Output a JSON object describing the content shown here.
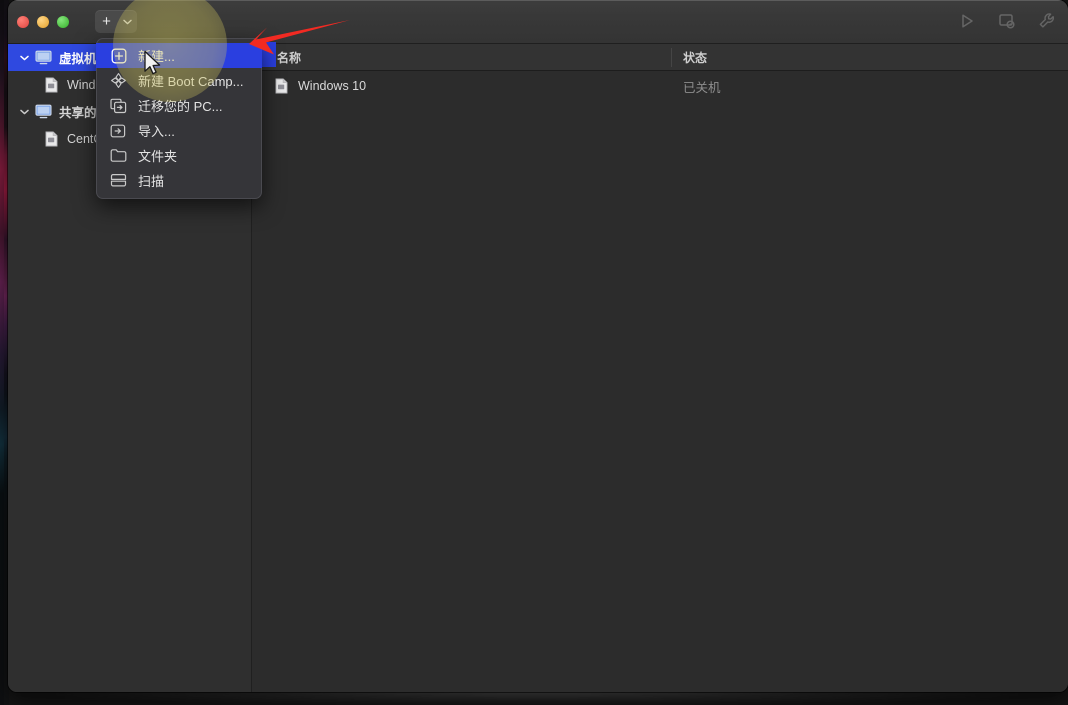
{
  "window": {
    "traffic_lights": [
      "close",
      "minimize",
      "maximize"
    ],
    "toolbar": {
      "add_button_label": "+",
      "add_chevron_icon": "chevron-down-icon",
      "right_icons": [
        "power-start-icon",
        "screenshot-icon",
        "wrench-icon"
      ]
    }
  },
  "sidebar": {
    "groups": [
      {
        "label": "虚拟机",
        "icon": "monitor-icon",
        "chevron": "chevron-down-icon",
        "selected": true,
        "children": [
          {
            "label": "Windows 10",
            "icon": "vm-doc-icon"
          }
        ]
      },
      {
        "label": "共享的",
        "icon": "monitor-icon",
        "chevron": "chevron-down-icon",
        "selected": false,
        "children": [
          {
            "label": "CentOS 7",
            "icon": "vm-doc-icon"
          }
        ]
      }
    ]
  },
  "content": {
    "columns": [
      {
        "key": "name",
        "label": "名称"
      },
      {
        "key": "status",
        "label": "状态"
      }
    ],
    "rows": [
      {
        "icon": "vm-doc-icon",
        "name": "Windows 10",
        "status": "已关机"
      }
    ]
  },
  "dropdown_menu": {
    "items": [
      {
        "label": "新建...",
        "icon": "plus-square-icon",
        "highlighted": true
      },
      {
        "label": "新建 Boot Camp...",
        "icon": "boot-camp-icon",
        "highlighted": false
      },
      {
        "label": "迁移您的 PC...",
        "icon": "migrate-pc-icon",
        "highlighted": false
      },
      {
        "label": "导入...",
        "icon": "import-icon",
        "highlighted": false
      },
      {
        "label": "文件夹",
        "icon": "folder-icon",
        "highlighted": false
      },
      {
        "label": "扫描",
        "icon": "scan-icon",
        "highlighted": false
      }
    ]
  },
  "annotations": {
    "arrow": {
      "icon": "red-arrow-icon",
      "color": "#f22a22",
      "points_to": "新建..."
    },
    "spotlight": {
      "icon": "spotlight-glow",
      "color": "#d6cc60"
    },
    "cursor": {
      "icon": "mouse-pointer-icon"
    }
  },
  "colors": {
    "selection_blue": "#2a3fe0",
    "titlebar": "#383838",
    "sidebar_bg": "#2f2f2f",
    "content_bg": "#2c2c2c",
    "menu_bg": "#353539",
    "annotation_red": "#f22a22"
  }
}
